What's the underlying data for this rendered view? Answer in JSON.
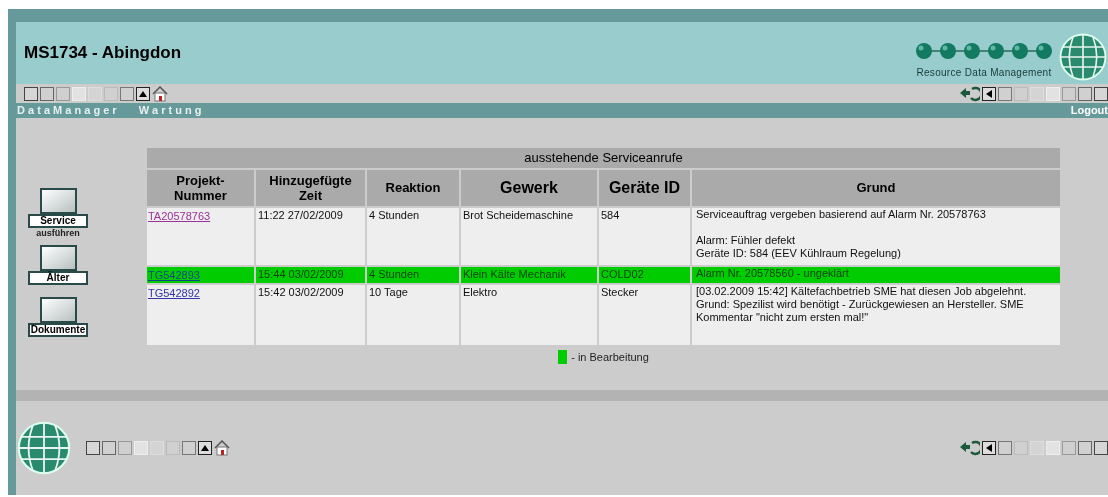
{
  "header": {
    "title": "MS1734 - Abingdon",
    "logo_text": "Resource Data Management"
  },
  "nav": {
    "items": [
      "D a t a M a n a g e r",
      "W a r t u n g"
    ],
    "logout": "Logout"
  },
  "sidebar": {
    "items": [
      {
        "label": "Service",
        "sublabel": "ausführen"
      },
      {
        "label": "Älter"
      },
      {
        "label": "Dokumente"
      }
    ]
  },
  "table": {
    "caption": "ausstehende Serviceanrufe",
    "columns": [
      "Projekt-Nummer",
      "Hinzugefügte Zeit",
      "Reaktion",
      "Gewerk",
      "Geräte ID",
      "Grund"
    ],
    "rows": [
      {
        "project": "TA20578763",
        "visited": true,
        "in_progress": false,
        "time": "11:22 27/02/2009",
        "reaction": "4 Stunden",
        "trade": "Brot Scheidemaschine",
        "device_id": "584",
        "reason": [
          [
            "Serviceauftrag vergeben basierend auf Alarm Nr. 20578763"
          ],
          [
            "Alarm: Fühler defekt",
            "Geräte ID: 584 (EEV Kühlraum Regelung)"
          ]
        ]
      },
      {
        "project": "TG542893",
        "visited": false,
        "in_progress": true,
        "time": "15:44 03/02/2009",
        "reaction": "4 Stunden",
        "trade": "Klein Kälte Mechanik",
        "device_id": "COLD02",
        "reason": [
          [
            "Alarm Nr. 20578560 - ungeklärt"
          ]
        ]
      },
      {
        "project": "TG542892",
        "visited": false,
        "in_progress": false,
        "time": "15:42 03/02/2009",
        "reaction": "10 Tage",
        "trade": "Elektro",
        "device_id": "Stecker",
        "reason": [
          [
            "[03.02.2009 15:42] Kältefachbetrieb SME hat diesen Job abgelehnt. Grund: Spezilist wird benötigt - Zurückgewiesen an Hersteller. SME Kommentar \"nicht zum ersten mal!\""
          ]
        ]
      }
    ]
  },
  "legend": {
    "label": "- in Bearbeitung",
    "color": "#00cc00"
  }
}
